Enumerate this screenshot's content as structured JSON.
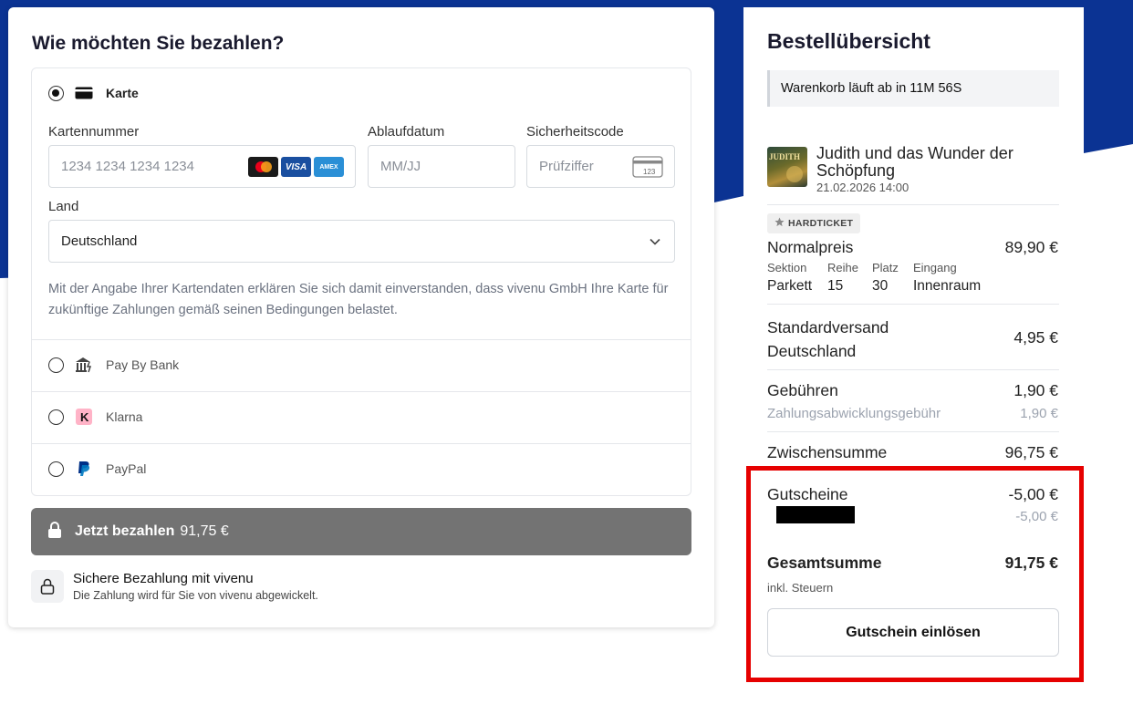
{
  "colors": {
    "brand_blue": "#0b3393",
    "pay_button": "#737373",
    "highlight": "#e60000"
  },
  "payment": {
    "title": "Wie möchten Sie bezahlen?",
    "methods": [
      {
        "label": "Karte",
        "selected": true,
        "icon": "credit-card-icon"
      },
      {
        "label": "Pay By Bank",
        "selected": false,
        "icon": "bank-icon"
      },
      {
        "label": "Klarna",
        "selected": false,
        "icon": "klarna-icon"
      },
      {
        "label": "PayPal",
        "selected": false,
        "icon": "paypal-icon"
      }
    ],
    "card": {
      "number_label": "Kartennummer",
      "number_placeholder": "1234 1234 1234 1234",
      "expiry_label": "Ablaufdatum",
      "expiry_placeholder": "MM/JJ",
      "cvc_label": "Sicherheitscode",
      "cvc_placeholder": "Prüfziffer",
      "cvc_icon_text": "123",
      "brand_logos": [
        "mastercard-logo",
        "VISA",
        "AMEX"
      ],
      "country_label": "Land",
      "country_value": "Deutschland",
      "consent": "Mit der Angabe Ihrer Kartendaten erklären Sie sich damit einverstanden, dass vivenu GmbH Ihre Karte für zukünftige Zahlungen gemäß seinen Bedingungen belastet."
    },
    "pay_button": {
      "label": "Jetzt bezahlen",
      "amount": "91,75 €",
      "icon": "lock-icon"
    },
    "secure": {
      "title": "Sichere Bezahlung mit vivenu",
      "subtitle": "Die Zahlung wird für Sie von vivenu abgewickelt.",
      "icon": "lock-icon"
    }
  },
  "summary": {
    "title": "Bestellübersicht",
    "timer": "Warenkorb läuft ab in 11M 56S",
    "event": {
      "title": "Judith und das Wunder der Schöpfung",
      "date": "21.02.2026 14:00",
      "thumb_text": "JUDITH"
    },
    "ticket": {
      "badge": "HARDTICKET",
      "name": "Normalpreis",
      "price": "89,90 €",
      "seat_headers": [
        "Sektion",
        "Reihe",
        "Platz",
        "Eingang"
      ],
      "seat_values": [
        "Parkett",
        "15",
        "30",
        "Innenraum"
      ]
    },
    "shipping": {
      "label_line1": "Standardversand",
      "label_line2": "Deutschland",
      "amount": "4,95 €"
    },
    "fees": {
      "label": "Gebühren",
      "amount": "1,90 €",
      "sub_label": "Zahlungsabwicklungsgebühr",
      "sub_amount": "1,90 €"
    },
    "subtotal": {
      "label": "Zwischensumme",
      "amount": "96,75 €"
    },
    "vouchers": {
      "label": "Gutscheine",
      "amount": "-5,00 €",
      "sub_amount": "-5,00 €"
    },
    "total": {
      "label": "Gesamtsumme",
      "amount": "91,75 €",
      "note": "inkl. Steuern"
    },
    "voucher_button": "Gutschein einlösen"
  }
}
